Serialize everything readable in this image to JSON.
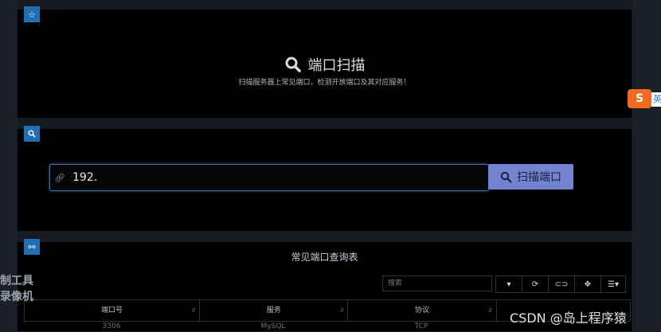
{
  "header": {
    "title": "端口扫描",
    "subtitle": "扫描服务器上常见端口，检测开放端口及其对应服务！"
  },
  "search": {
    "value": "192.",
    "button_label": "扫描端口"
  },
  "table": {
    "title": "常见端口查询表",
    "search_placeholder": "搜索",
    "columns": [
      "端口号",
      "服务",
      "协议"
    ],
    "partial_row": [
      "3306",
      "MySQL",
      "TCP"
    ]
  },
  "overlay": {
    "ime_label": "S",
    "ime_tail": "英",
    "left_text_1": "制工具",
    "left_text_2": "录像机",
    "watermark": "CSDN @岛上程序猿"
  },
  "colors": {
    "accent": "#7383cf",
    "badge": "#1f6fb4",
    "panel": "#000000",
    "background": "#161a22"
  },
  "icons": [
    "star-icon",
    "search-icon",
    "link-icon",
    "collapse-icon",
    "refresh-icon",
    "toggle-icon",
    "fullscreen-icon",
    "columns-icon"
  ]
}
